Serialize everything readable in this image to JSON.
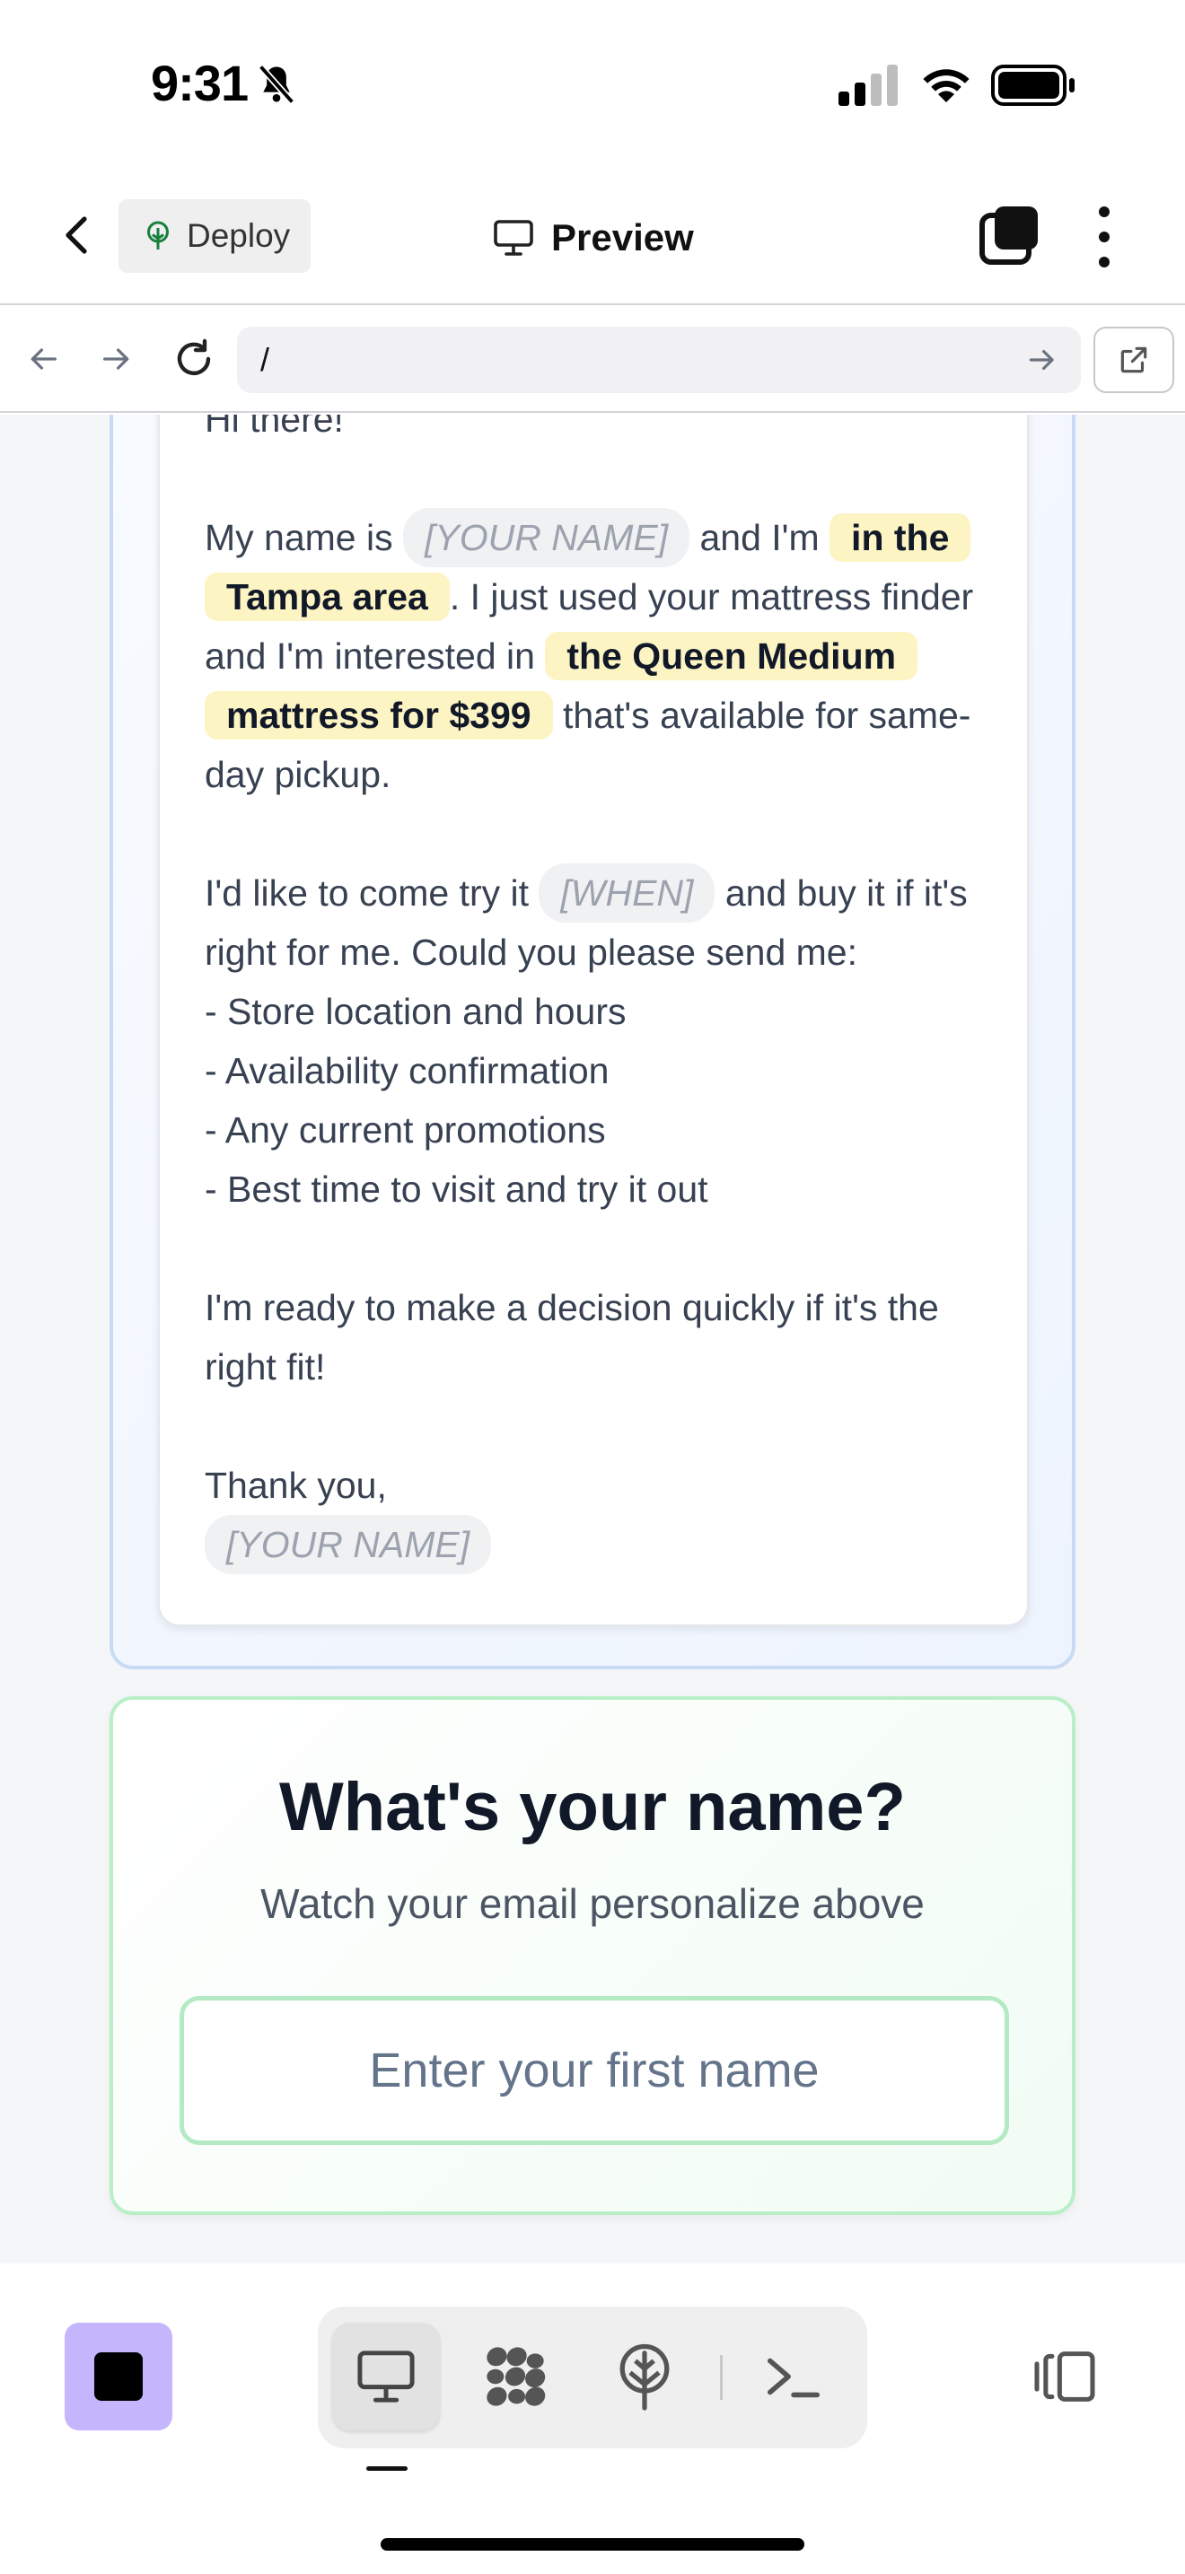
{
  "status_bar": {
    "time": "9:31",
    "icons": [
      "bell-slash-icon",
      "cellular-signal-icon",
      "wifi-icon",
      "battery-icon"
    ]
  },
  "top_nav": {
    "deploy_label": "Deploy",
    "preview_label": "Preview",
    "icons": [
      "chevron-left-icon",
      "tree-icon",
      "monitor-icon",
      "tabs-icon",
      "more-vertical-icon"
    ]
  },
  "url_bar": {
    "url": "/",
    "icons": [
      "arrow-left-icon",
      "arrow-right-icon",
      "reload-icon",
      "go-arrow-icon",
      "external-link-icon"
    ]
  },
  "email": {
    "greeting": "Hi there!",
    "p1": {
      "t1": "My name is ",
      "name_placeholder": "[YOUR NAME]",
      "t2": " and I'm ",
      "location": "in the Tampa area",
      "t3": ". I just used your mattress finder and I'm interested in ",
      "product": "the Queen Medium mattress for $399",
      "t4": " that's available for same-day pickup."
    },
    "p2": {
      "t1": "I'd like to come try it ",
      "when_placeholder": "[WHEN]",
      "t2": " and buy it if it's right for me. Could you please send me:",
      "list": [
        "- Store location and hours",
        "- Availability confirmation",
        "- Any current promotions",
        "- Best time to visit and try it out"
      ]
    },
    "p3": "I'm ready to make a decision quickly if it's the right fit!",
    "signoff": "Thank you,",
    "signature_placeholder": "[YOUR NAME]"
  },
  "name_card": {
    "title": "What's your name?",
    "subtitle": "Watch your email personalize above",
    "input_placeholder": "Enter your first name",
    "input_value": ""
  },
  "bottom_bar": {
    "icons": [
      "stop-icon",
      "monitor-icon",
      "apps-grid-icon",
      "deploy-tree-icon",
      "terminal-icon",
      "panel-toggle-icon"
    ],
    "colors": {
      "stop_button": "#c4b5fd",
      "active_tool_bg": "#e2e2e2"
    }
  },
  "colors": {
    "highlight_bg": "#fdf4c4",
    "placeholder_bg": "#f0f1f3",
    "email_border": "#c7dbf5",
    "name_card_border": "#b9efc7"
  }
}
